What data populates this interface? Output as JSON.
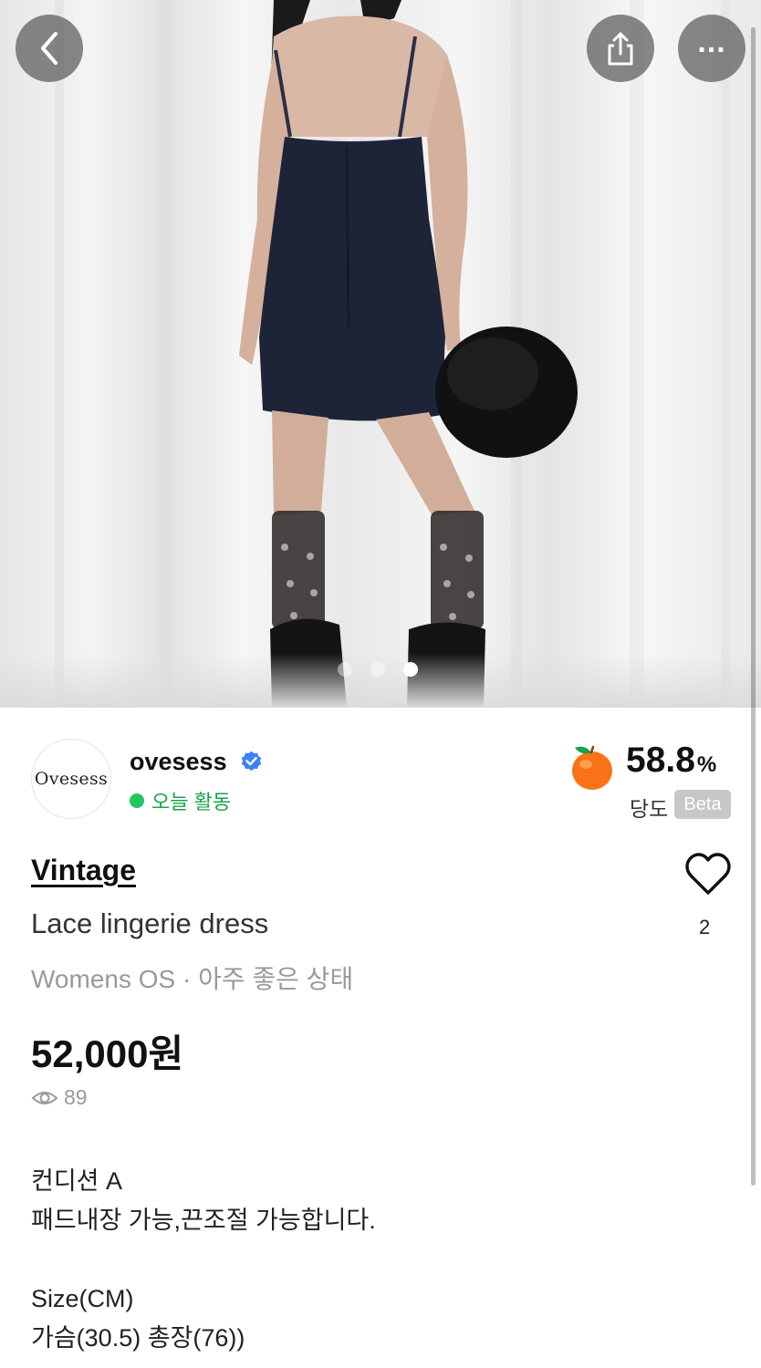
{
  "header": {
    "back_icon": "chevron-left-icon",
    "share_icon": "share-icon",
    "more_icon": "more-horizontal-icon",
    "more_glyph": "..."
  },
  "gallery": {
    "image_count": 3,
    "active_index": 2
  },
  "seller": {
    "avatar_text": "Ovesess",
    "name": "ovesess",
    "verified_icon": "verified-badge-icon",
    "activity": "오늘 활동",
    "activity_color": "#22c55e"
  },
  "sweetness": {
    "icon": "orange-fruit-icon",
    "value": "58.8",
    "unit": "%",
    "label": "당도",
    "badge": "Beta"
  },
  "product": {
    "brand": "Vintage",
    "title": "Lace lingerie dress",
    "meta": "Womens OS · 아주 좋은 상태",
    "like_icon": "heart-outline-icon",
    "like_count": "2",
    "price": "52,000원",
    "view_icon": "eye-icon",
    "view_count": "89"
  },
  "description": {
    "lines": [
      "컨디션 A",
      "패드내장 가능,끈조절 가능합니다.",
      "",
      "Size(CM)",
      "가슴(30.5) 총장(76))"
    ]
  }
}
